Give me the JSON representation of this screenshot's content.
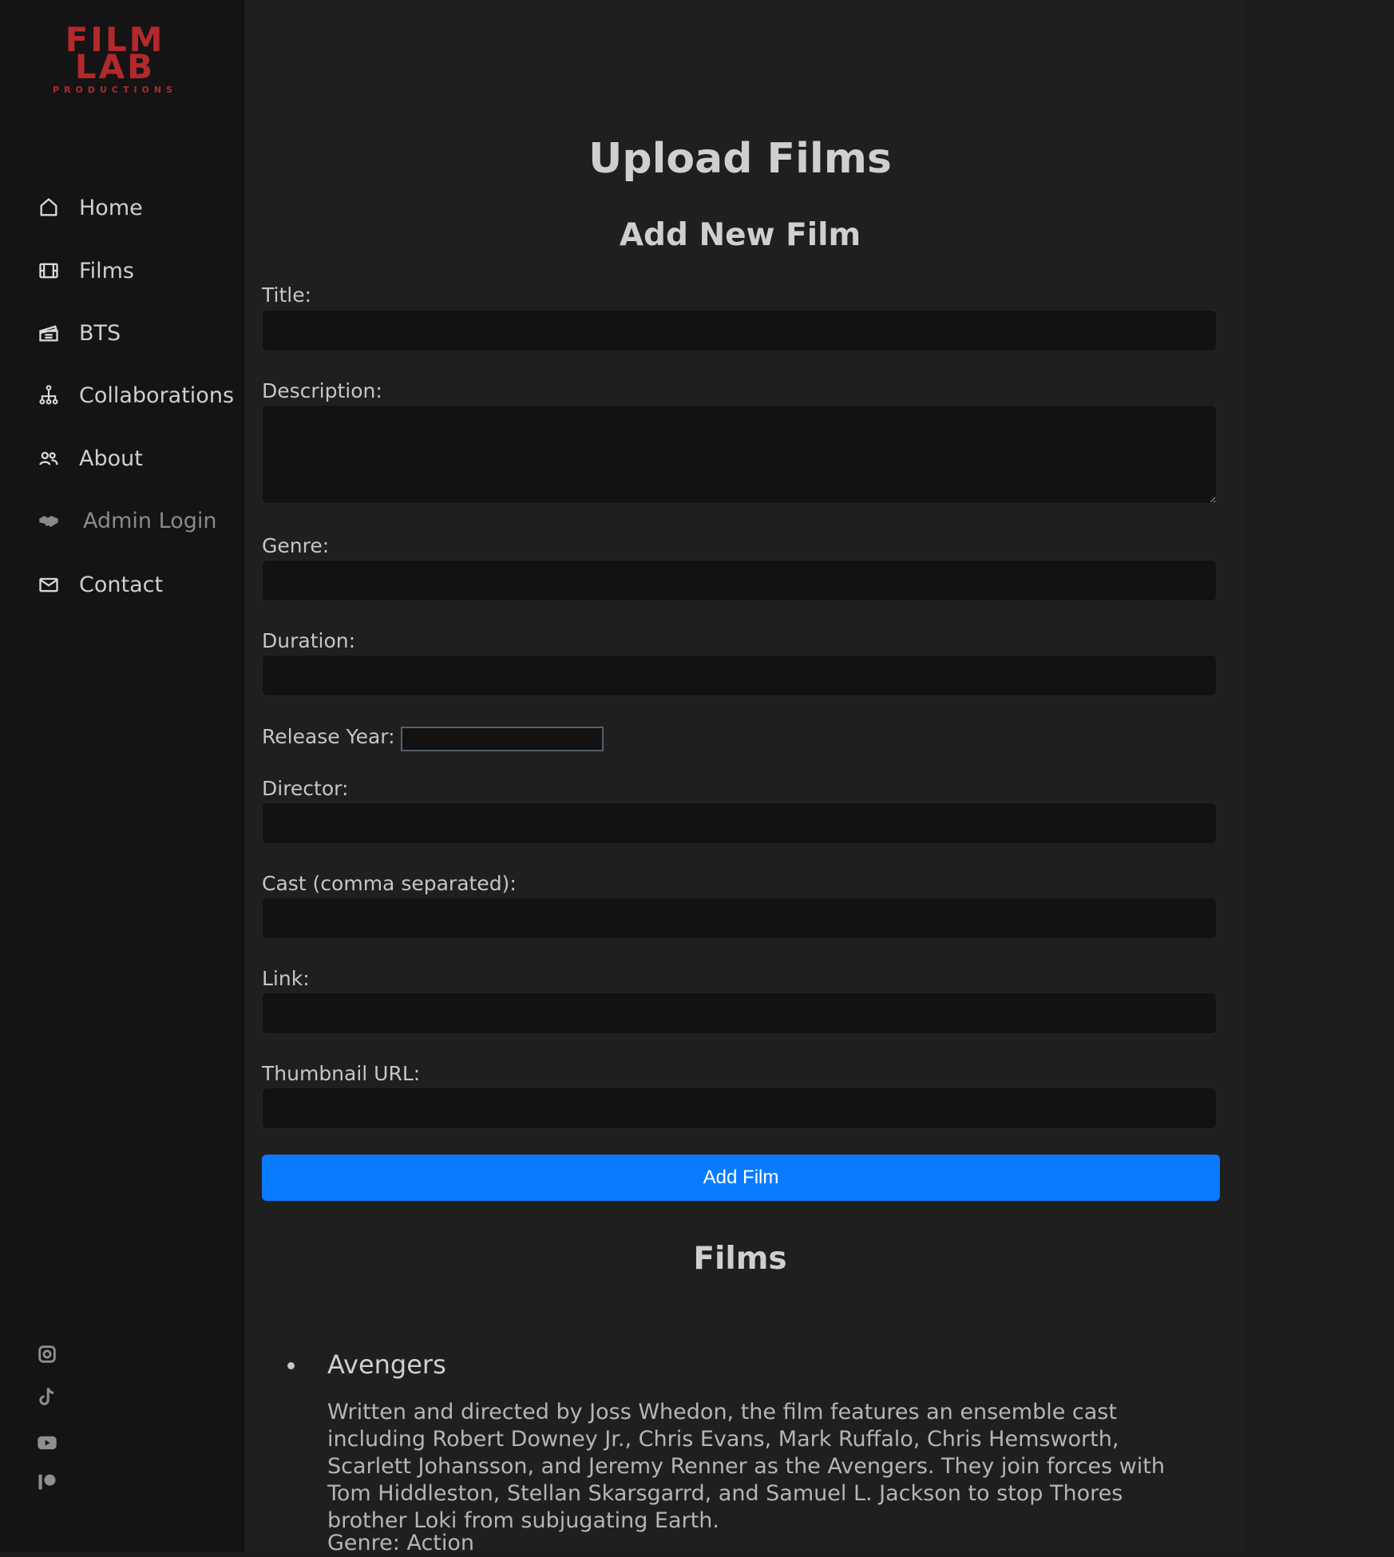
{
  "brand": {
    "logo_line1": "FILM",
    "logo_line2": "LAB",
    "logo_sub": "PRODUCTIONS",
    "color": "#b3282b"
  },
  "sidebar": {
    "items": [
      {
        "label": "Home",
        "icon": "home-icon"
      },
      {
        "label": "Films",
        "icon": "film-icon"
      },
      {
        "label": "BTS",
        "icon": "clapperboard-icon"
      },
      {
        "label": "Collaborations",
        "icon": "network-icon"
      },
      {
        "label": "About",
        "icon": "users-icon"
      },
      {
        "label": "Admin Login",
        "icon": "handshake-icon"
      },
      {
        "label": "Contact",
        "icon": "mail-icon"
      }
    ],
    "social": [
      "instagram-icon",
      "tiktok-icon",
      "youtube-icon",
      "patreon-icon"
    ]
  },
  "main": {
    "page_title": "Upload Films",
    "form_title": "Add New Film",
    "fields": {
      "title": "Title:",
      "description": "Description:",
      "genre": "Genre:",
      "duration": "Duration:",
      "release_year": "Release Year:",
      "director": "Director:",
      "cast": "Cast (comma separated):",
      "link": "Link:",
      "thumbnail": "Thumbnail URL:"
    },
    "submit_label": "Add Film",
    "accent_color": "#0a7bff",
    "list_title": "Films",
    "films": [
      {
        "title": "Avengers",
        "description": "Written and directed by Joss Whedon, the film features an ensemble cast including Robert Downey Jr., Chris Evans, Mark Ruffalo, Chris Hemsworth, Scarlett Johansson, and Jeremy Renner as the Avengers. They join forces with Tom Hiddleston, Stellan Skarsgarrd, and Samuel L. Jackson to stop Thores brother Loki from subjugating Earth.",
        "genre": "Genre: Action"
      }
    ]
  }
}
